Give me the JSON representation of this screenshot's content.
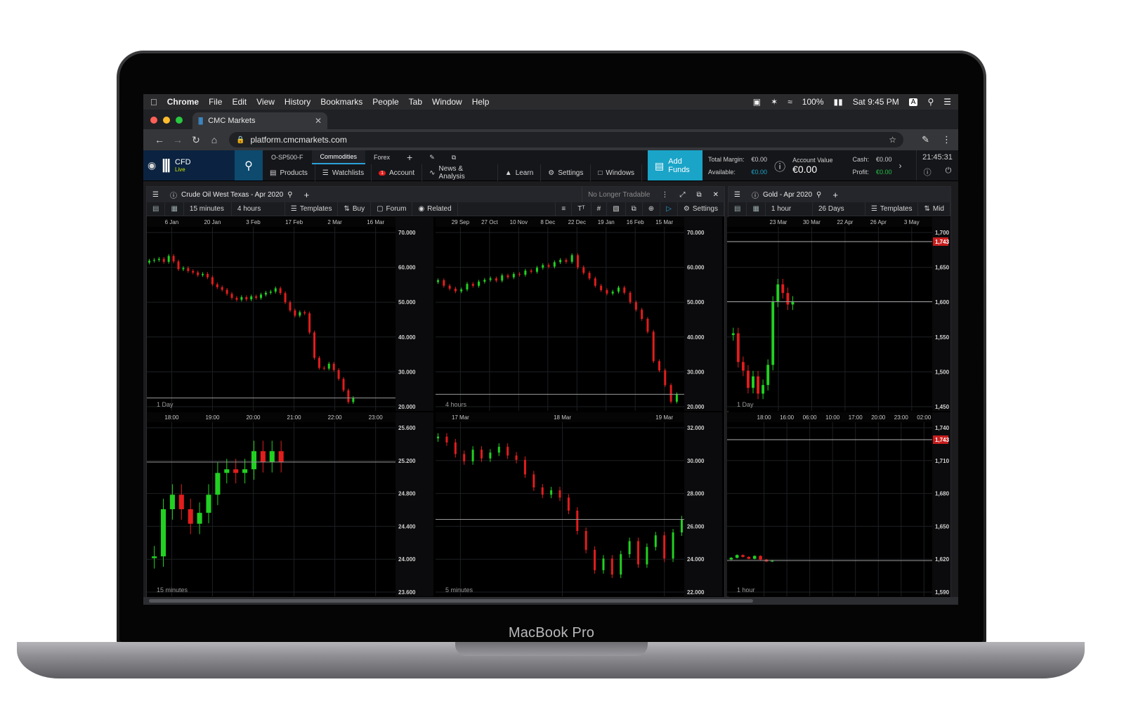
{
  "device_label": "MacBook Pro",
  "menubar": {
    "items": [
      "Chrome",
      "File",
      "Edit",
      "View",
      "History",
      "Bookmarks",
      "People",
      "Tab",
      "Window",
      "Help"
    ],
    "battery": "100%",
    "clock": "Sat 9:45 PM",
    "input_badge": "A"
  },
  "browser": {
    "tab_title": "CMC Markets",
    "url": "platform.cmcmarkets.com"
  },
  "cmc": {
    "account_type": "CFD",
    "live_label": "Live",
    "workspace_tabs": [
      "O-SP500-F",
      "Commodities",
      "Forex"
    ],
    "nav": [
      "Products",
      "Watchlists",
      "Account",
      "News & Analysis",
      "Learn",
      "Settings",
      "Windows"
    ],
    "account_badge": "1",
    "add_funds": "Add Funds",
    "total_margin_label": "Total Margin:",
    "total_margin": "€0.00",
    "available_label": "Available:",
    "available": "€0.00",
    "account_value_label": "Account Value",
    "account_value": "€0.00",
    "cash_label": "Cash:",
    "cash": "€0.00",
    "profit_label": "Profit:",
    "profit": "€0.00",
    "time": "21:45:31"
  },
  "panel_left": {
    "title": "Crude Oil West Texas - Apr 2020",
    "status": "No Longer Tradable",
    "tools": [
      "15 minutes",
      "4 hours",
      "Templates",
      "Buy",
      "Forum",
      "Related",
      "Settings"
    ]
  },
  "panel_right": {
    "title": "Gold - Apr 2020",
    "tools": [
      "1 hour",
      "26 Days",
      "Templates",
      "Mid"
    ],
    "price_tag": "1,743"
  },
  "chart_data": [
    {
      "type": "candlestick",
      "timeframe_label": "1 Day",
      "x_tick_labels": [
        "6 Jan",
        "20 Jan",
        "3 Feb",
        "17 Feb",
        "2 Mar",
        "16 Mar"
      ],
      "y_tick_labels": [
        "70.000",
        "60.000",
        "50.000",
        "40.000",
        "30.000",
        "20.000"
      ],
      "ylim": [
        20,
        70
      ],
      "closes": [
        60.8,
        61.0,
        61.3,
        60.5,
        62.1,
        60.6,
        58.5,
        58.8,
        58.0,
        57.6,
        56.9,
        57.2,
        56.3,
        54.4,
        53.6,
        52.9,
        51.8,
        50.7,
        50.2,
        50.9,
        50.3,
        51.1,
        50.7,
        51.6,
        52.1,
        52.4,
        53.3,
        52.0,
        49.5,
        47.3,
        45.9,
        46.8,
        46.5,
        41.3,
        34.4,
        31.7,
        31.5,
        32.8,
        31.1,
        28.7,
        25.6,
        22.4,
        23.5
      ]
    },
    {
      "type": "candlestick",
      "timeframe_label": "4 hours",
      "x_tick_labels": [
        "29 Sep",
        "27 Oct",
        "10 Nov",
        "8 Dec",
        "22 Dec",
        "19 Jan",
        "16 Feb",
        "15 Mar"
      ],
      "y_tick_labels": [
        "70.000",
        "60.000",
        "50.000",
        "40.000",
        "30.000",
        "20.000"
      ],
      "ylim": [
        20,
        70
      ],
      "closes": [
        55.5,
        54.0,
        53.2,
        52.5,
        53.0,
        54.5,
        54.0,
        55.1,
        55.6,
        56.0,
        55.4,
        56.8,
        56.3,
        57.2,
        57.0,
        58.1,
        57.8,
        58.9,
        59.6,
        59.2,
        60.4,
        61.0,
        60.5,
        62.3,
        59.0,
        57.5,
        56.0,
        54.0,
        52.8,
        51.9,
        52.4,
        53.5,
        52.1,
        49.5,
        47.5,
        45.0,
        41.5,
        33.5,
        31.0,
        27.0,
        22.5,
        24.5
      ]
    },
    {
      "type": "candlestick",
      "timeframe_label": "1 Day",
      "x_tick_labels": [
        "23 Mar",
        "30 Mar",
        "22 Apr",
        "26 Apr",
        "3 May"
      ],
      "y_tick_labels": [
        "1,700",
        "1,650",
        "1,600",
        "1,550",
        "1,500",
        "1,450"
      ],
      "ylim": [
        1440,
        1760
      ],
      "closes": [
        1575,
        1525,
        1510,
        1480,
        1500,
        1470,
        1485,
        1520,
        1630,
        1660,
        1645,
        1625,
        1630
      ]
    },
    {
      "type": "candlestick",
      "timeframe_label": "15 minutes",
      "x_tick_labels": [
        "18:00",
        "19:00",
        "20:00",
        "21:00",
        "22:00",
        "23:00"
      ],
      "y_tick_labels": [
        "25.600",
        "25.200",
        "24.800",
        "24.400",
        "24.000",
        "23.600"
      ],
      "ylim": [
        23.2,
        25.6
      ],
      "closes": [
        23.75,
        24.4,
        24.6,
        24.4,
        24.2,
        24.35,
        24.6,
        24.9,
        24.95,
        24.9,
        24.95,
        25.2,
        25.05,
        25.2,
        25.05
      ]
    },
    {
      "type": "candlestick",
      "timeframe_label": "5 minutes",
      "x_tick_labels": [
        "17 Mar",
        "18 Mar",
        "19 Mar"
      ],
      "y_tick_labels": [
        "32.000",
        "30.000",
        "28.000",
        "26.000",
        "24.000",
        "22.000"
      ],
      "ylim": [
        20,
        32
      ],
      "closes": [
        31.0,
        30.6,
        29.8,
        29.3,
        30.1,
        29.5,
        29.9,
        30.3,
        29.7,
        29.4,
        28.4,
        27.5,
        27.0,
        27.3,
        26.8,
        25.9,
        24.5,
        23.2,
        21.8,
        22.6,
        21.5,
        22.9,
        23.8,
        22.2,
        23.4,
        24.2,
        22.6,
        24.4,
        25.3
      ]
    },
    {
      "type": "candlestick",
      "timeframe_label": "1 hour",
      "x_tick_labels": [
        "18:00",
        "16:00",
        "06:00",
        "10:00",
        "17:00",
        "20:00",
        "23:00",
        "02:00"
      ],
      "y_tick_labels": [
        "1,740",
        "1,710",
        "1,680",
        "1,650",
        "1,620",
        "1,590"
      ],
      "ylim": [
        1580,
        1770
      ],
      "closes": [
        1622,
        1625,
        1623,
        1621,
        1624,
        1620,
        1618,
        1619
      ]
    }
  ]
}
